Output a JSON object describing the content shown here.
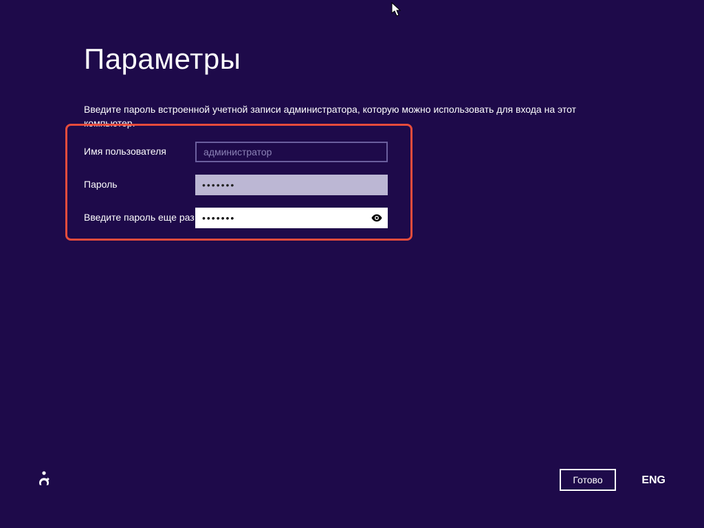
{
  "header": {
    "title": "Параметры"
  },
  "instruction": "Введите пароль встроенной учетной записи администратора, которую можно использовать для входа на этот компьютер.",
  "form": {
    "username": {
      "label": "Имя пользователя",
      "value": "администратор"
    },
    "password": {
      "label": "Пароль",
      "value": "•••••••"
    },
    "confirm": {
      "label": "Введите пароль еще раз",
      "value": "•••••••"
    }
  },
  "footer": {
    "done_label": "Готово",
    "language": "ENG"
  }
}
